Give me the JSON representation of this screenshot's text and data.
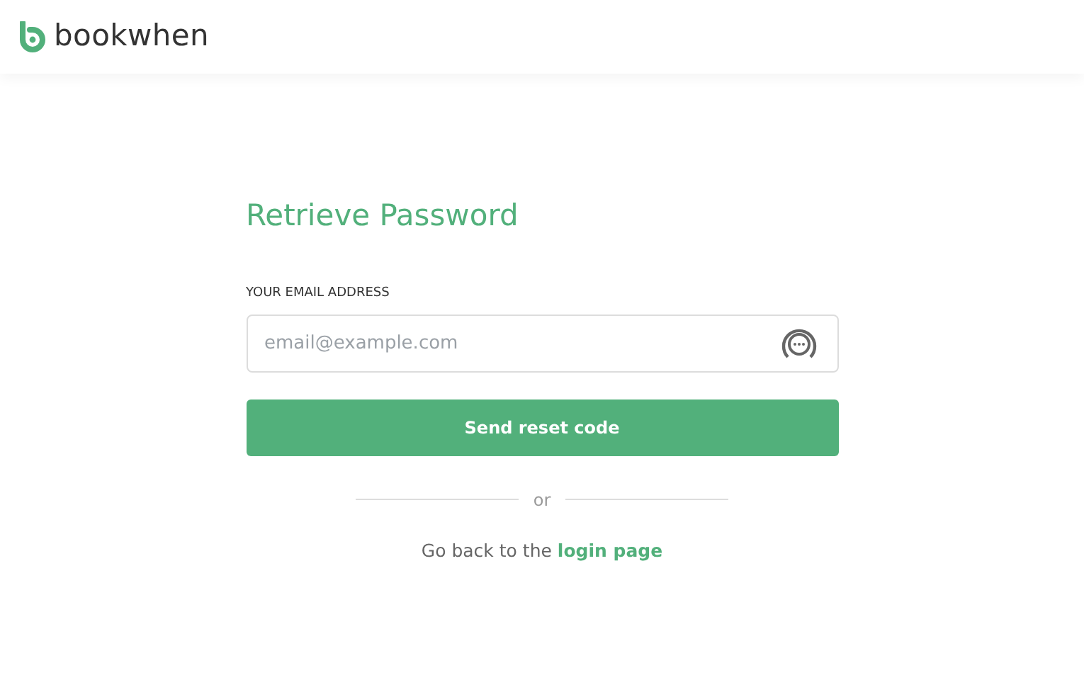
{
  "header": {
    "logo_text": "bookwhen"
  },
  "form": {
    "title": "Retrieve Password",
    "email_label": "YOUR EMAIL ADDRESS",
    "email_placeholder": "email@example.com",
    "submit_button": "Send reset code",
    "divider_text": "or",
    "back_text": "Go back to the",
    "back_link": "login page"
  }
}
